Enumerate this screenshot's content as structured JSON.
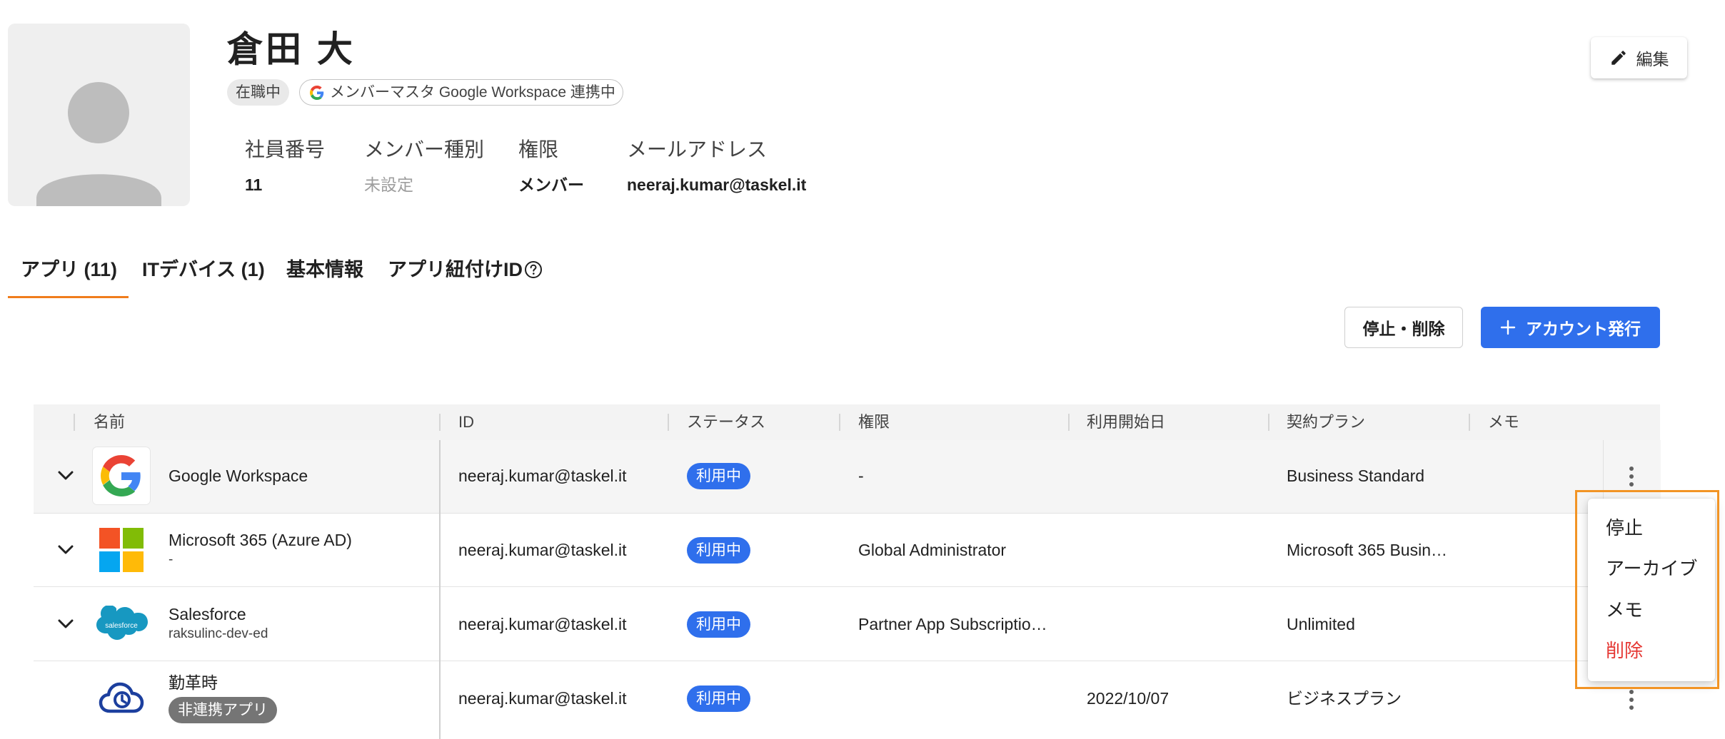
{
  "profile": {
    "name": "倉田 大",
    "status_chip": "在職中",
    "sync_chip": "メンバーマスタ Google Workspace 連携中",
    "edit_label": "編集",
    "fields": {
      "employee_no_label": "社員番号",
      "employee_no": "11",
      "member_type_label": "メンバー種別",
      "member_type": "未設定",
      "role_label": "権限",
      "role": "メンバー",
      "email_label": "メールアドレス",
      "email": "neeraj.kumar@taskel.it"
    }
  },
  "tabs": [
    {
      "label": "アプリ (11)",
      "active": true
    },
    {
      "label": "ITデバイス (1)"
    },
    {
      "label": "基本情報"
    },
    {
      "label": "アプリ紐付けID"
    }
  ],
  "actions": {
    "stop_delete": "停止・削除",
    "issue_account": "アカウント発行"
  },
  "table": {
    "headers": [
      "名前",
      "ID",
      "ステータス",
      "権限",
      "利用開始日",
      "契約プラン",
      "メモ"
    ],
    "rows": [
      {
        "app": "Google Workspace",
        "sub": "",
        "id": "neeraj.kumar@taskel.it",
        "status": "利用中",
        "role": "-",
        "start": "",
        "plan": "Business Standard",
        "icon": "google-logo"
      },
      {
        "app": "Microsoft 365 (Azure AD)",
        "sub": "-",
        "id": "neeraj.kumar@taskel.it",
        "status": "利用中",
        "role": "Global Administrator",
        "start": "",
        "plan": "Microsoft 365 Busin…",
        "icon": "microsoft-logo"
      },
      {
        "app": "Salesforce",
        "sub": "raksulinc-dev-ed",
        "id": "neeraj.kumar@taskel.it",
        "status": "利用中",
        "role": "Partner App Subscriptio…",
        "start": "",
        "plan": "Unlimited",
        "icon": "salesforce-logo",
        "logo_text": "salesforce"
      },
      {
        "app": "勤革時",
        "sub_badge": "非連携アプリ",
        "id": "neeraj.kumar@taskel.it",
        "status": "利用中",
        "role": "",
        "start": "2022/10/07",
        "plan": "ビジネスプラン",
        "icon": "cloud-clock-logo"
      }
    ]
  },
  "menu": {
    "items": [
      "停止",
      "アーカイブ",
      "メモ",
      "削除"
    ],
    "danger_index": 3
  },
  "colors": {
    "primary": "#2f6fec",
    "accent_orange": "#f07d1c",
    "danger": "#e53935"
  }
}
